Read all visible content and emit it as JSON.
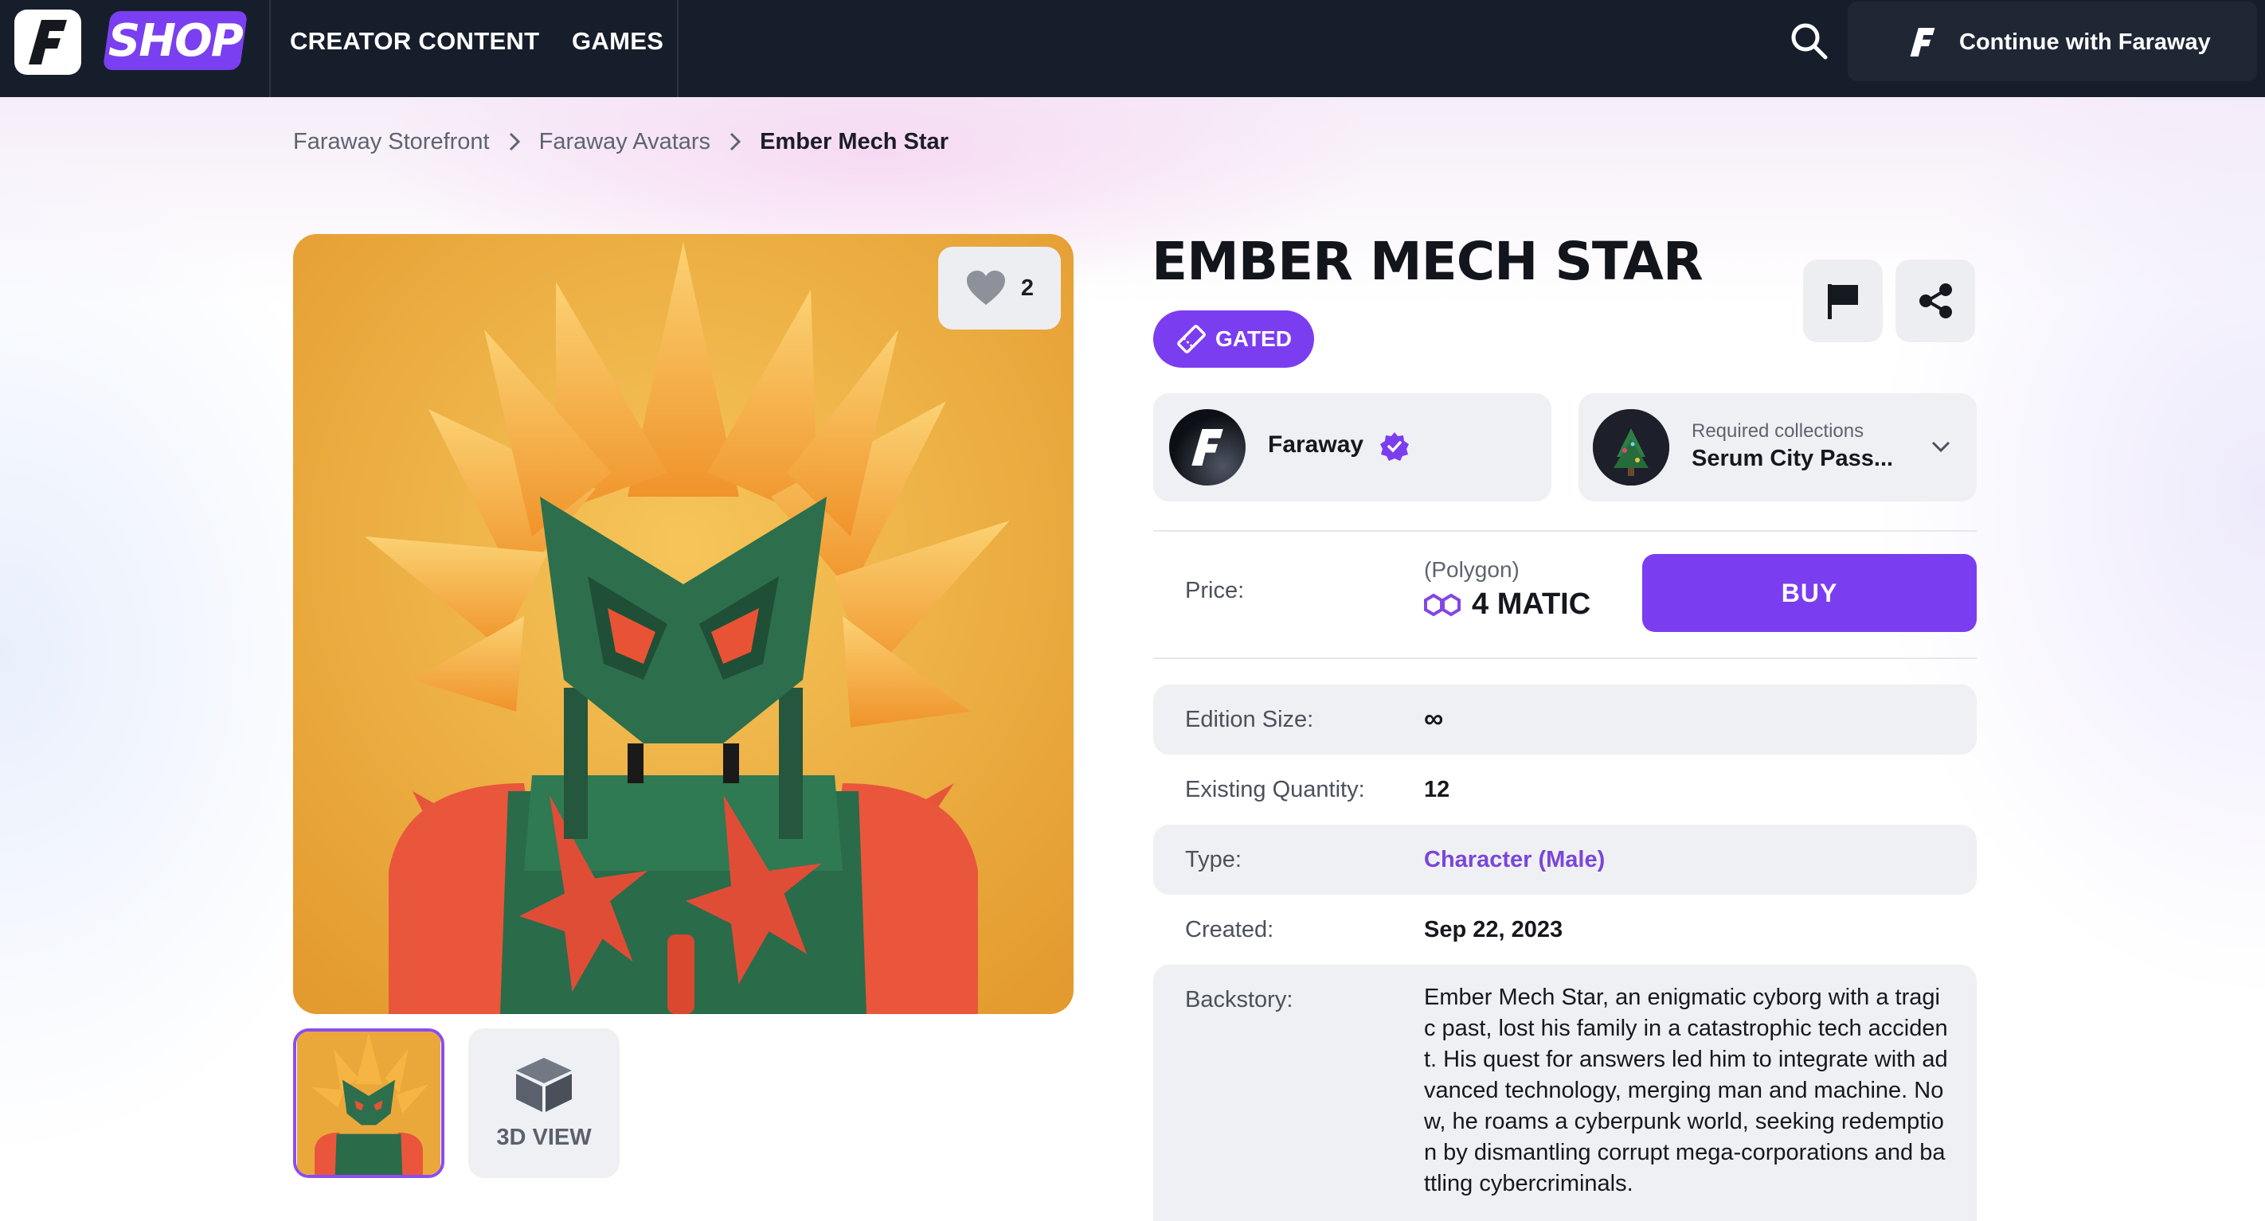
{
  "nav": {
    "shop_logo": "SHOP",
    "links": [
      "CREATOR CONTENT",
      "GAMES"
    ],
    "continue_label": "Continue with Faraway"
  },
  "breadcrumb": [
    "Faraway Storefront",
    "Faraway Avatars",
    "Ember Mech Star"
  ],
  "media": {
    "likes": "2",
    "view3d_label": "3D VIEW"
  },
  "item": {
    "title": "EMBER MECH STAR",
    "badge": "GATED",
    "creator": "Faraway",
    "required_label": "Required collections",
    "required_value": "Serum City Pass...",
    "price_label": "Price:",
    "price_network": "(Polygon)",
    "price_value": "4 MATIC",
    "buy_label": "BUY",
    "details": [
      {
        "key": "Edition Size:",
        "value": "∞"
      },
      {
        "key": "Existing Quantity:",
        "value": "12"
      },
      {
        "key": "Type:",
        "value": "Character (Male)"
      },
      {
        "key": "Created:",
        "value": "Sep 22, 2023"
      },
      {
        "key": "Backstory:",
        "value": "Ember Mech Star, an enigmatic cyborg with a tragic past, lost his family in a catastrophic tech accident. His quest for answers led him to integrate with advanced technology, merging man and machine. Now, he roams a cyberpunk world, seeking redemption by dismantling corrupt mega-corporations and battling cybercriminals."
      }
    ]
  },
  "colors": {
    "nav_bg": "#161e2b",
    "accent": "#7b3df0",
    "link": "#7a46d9",
    "card_bg": "#eff0f3",
    "hero_bg": "#e9a53a"
  },
  "icons": [
    "faraway-logo-icon",
    "search-icon",
    "chevron-right-icon",
    "heart-icon",
    "cube-icon",
    "ticket-icon",
    "flag-icon",
    "share-icon",
    "verified-badge-icon",
    "chevron-down-icon",
    "polygon-icon"
  ]
}
